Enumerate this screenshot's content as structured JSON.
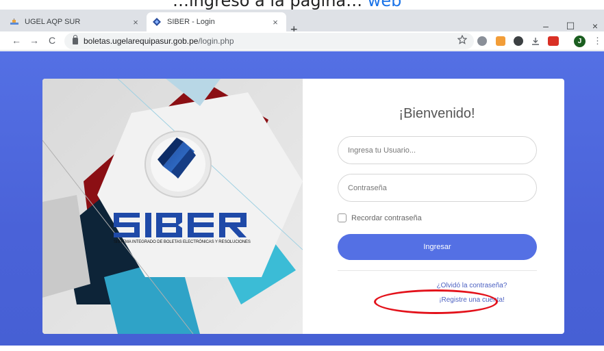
{
  "caption": {
    "text": "…ingreso a la página… ",
    "link_text": "web"
  },
  "browser": {
    "tabs": [
      {
        "title": "UGEL AQP SUR",
        "active": false,
        "close": "×"
      },
      {
        "title": "SIBER - Login",
        "active": true,
        "close": "×"
      }
    ],
    "new_tab": "+",
    "window_controls": {
      "minimize": "–",
      "maximize": "☐",
      "close": "×"
    },
    "nav": {
      "back": "←",
      "forward": "→",
      "reload": "C"
    },
    "address": {
      "host": "boletas.ugelarequipasur.gob.pe",
      "path": "/login.php"
    },
    "bookmark_icon": "star-icon",
    "profile_initial": "J",
    "menu": "⋮"
  },
  "hero": {
    "logo_text": "SIBER",
    "tagline": "SISTEMA INTEGRADO DE BOLETAS ELECTRÓNICAS Y RESOLUCIONES"
  },
  "login": {
    "heading": "¡Bienvenido!",
    "username_placeholder": "Ingresa tu Usuario...",
    "password_placeholder": "Contraseña",
    "remember_label": "Recordar contraseña",
    "submit_label": "Ingresar",
    "forgot_link": "¿Olvidó la contraseña?",
    "register_link": "¡Registre una cuenta!"
  },
  "colors": {
    "page_bg": "#5470e4",
    "button_bg": "#5470e4",
    "link": "#4a5fc1",
    "highlight": "#e3121b"
  }
}
